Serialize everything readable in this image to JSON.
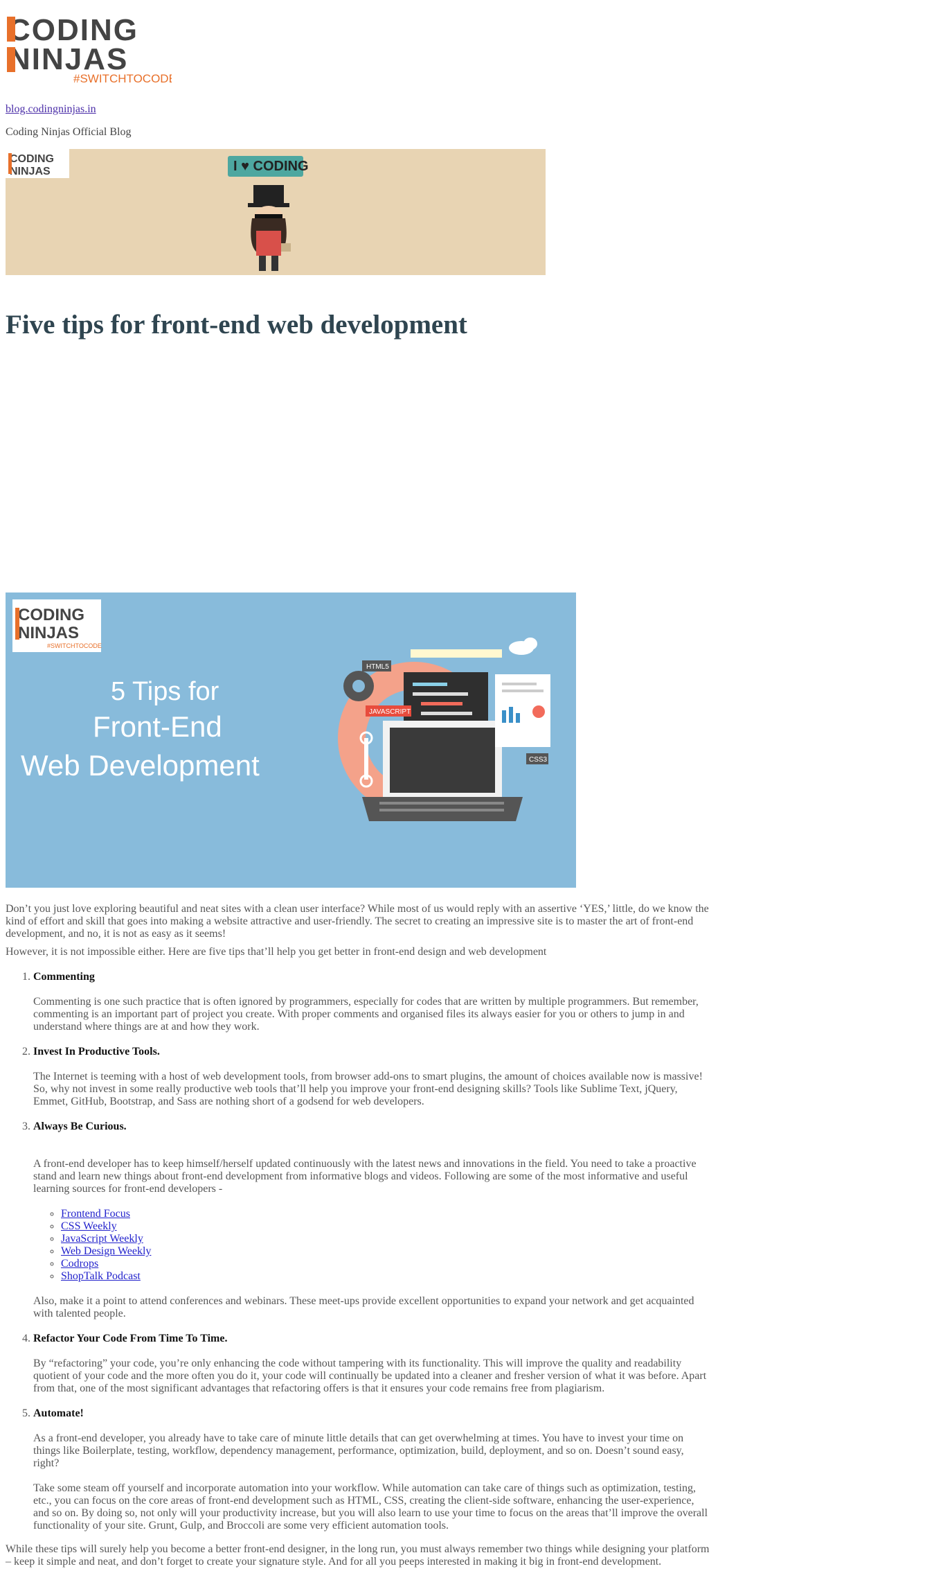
{
  "header": {
    "logo_line1": "CODING",
    "logo_line2": "NINJAS",
    "logo_tag": "#SWITCHTOCODE",
    "site_link": "blog.codingninjas.in",
    "tagline": "Coding Ninjas Official Blog"
  },
  "banner": {
    "badge": "I ♥ CODING",
    "logo_line1": "CODING",
    "logo_line2": "NINJAS"
  },
  "post": {
    "title": "Five tips for front-end web development",
    "hero": {
      "logo_line1": "CODING",
      "logo_line2": "NINJAS",
      "logo_tag": "#SWITCHTOCODE",
      "line1": "5 Tips for",
      "line2": "Front-End",
      "line3": "Web Development",
      "tag_html": "HTML5",
      "tag_js": "JAVASCRIPT",
      "tag_css": "CSS3"
    },
    "intro1": "Don’t you just love exploring beautiful and neat sites with a clean user interface? While most of us would reply with an assertive ‘YES,’ little, do we know the kind of effort and skill that goes into making a website attractive and user-friendly. The secret to creating an impressive site is to master the art of front-end development, and no, it is not as easy as it seems!",
    "intro2": "However, it is not impossible either. Here are five tips that’ll help you get better in front-end design and web development",
    "tips": [
      {
        "title": "Commenting",
        "body": "Commenting is one such practice that is often ignored by programmers, especially for codes that are written by multiple programmers. But remember, commenting is an important part of project you create. With proper comments and organised files its always easier for you or others to jump in and understand where things are at and how they work."
      },
      {
        "title": "Invest In Productive Tools.",
        "body": "The Internet is teeming with a host of web development tools, from browser add-ons to smart plugins, the amount of choices available now is massive! So, why not invest in some really productive web tools that’ll help you improve your front-end designing skills? Tools like Sublime Text, jQuery, Emmet, GitHub, Bootstrap, and Sass are nothing short of a godsend for web developers."
      },
      {
        "title": "Always Be Curious.",
        "body": "A front-end developer has to keep himself/herself updated continuously with the latest news and innovations in the field. You need to take a proactive stand and learn new things about front-end development from informative blogs and videos. Following are some of the most informative and useful learning sources for front-end developers -",
        "resources": [
          "Frontend Focus",
          "CSS Weekly",
          "JavaScript Weekly",
          "Web Design Weekly",
          "Codrops",
          "ShopTalk Podcast"
        ],
        "after": "Also, make it a point to attend conferences and webinars. These meet-ups provide excellent opportunities to expand your network and get acquainted with talented people."
      },
      {
        "title": "Refactor Your Code From Time To Time.",
        "body": "By “refactoring” your code, you’re only enhancing the code without tampering with its functionality. This will improve the quality and readability quotient of your code and the more often you do it, your code will continually be updated into a cleaner and fresher version of what it was before. Apart from that, one of the most significant advantages that refactoring offers is that it ensures your code remains free from plagiarism."
      },
      {
        "title": "Automate!",
        "body": "As a front-end developer, you already have to take care of minute little details that can get overwhelming at times. You have to invest your time on things like Boilerplate, testing, workflow, dependency management, performance, optimization, build, deployment, and so on. Doesn’t sound easy, right?",
        "body2": "Take some steam off yourself and incorporate automation into your workflow. While automation can take care of things such as optimization, testing, etc., you can focus on the core areas of front-end development such as HTML, CSS, creating the client-side software, enhancing the user-experience, and so on. By doing so, not only will your productivity increase, but you will also learn to use your time to focus on the areas that’ll improve the overall functionality of your site. Grunt, Gulp, and Broccoli are some very efficient automation tools."
      }
    ],
    "closing": "While these tips will surely help you become a better front-end designer, in the long run, you must always remember two things while designing your platform – keep it simple and neat, and don’t forget to create your signature style. And for all you peeps interested in making it big in front-end development."
  },
  "colors": {
    "brand_orange": "#e8702a",
    "brand_dark": "#444444",
    "title": "#2f4550",
    "banner_bg": "#e8d4b3",
    "hero_bg": "#88bbdb"
  }
}
